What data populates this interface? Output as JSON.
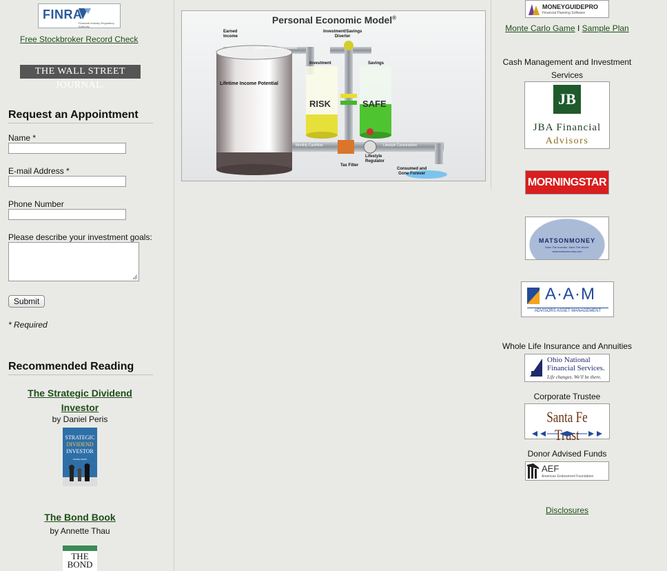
{
  "left": {
    "finra_logo_text": "FINRA",
    "finra_logo_sub": "Financial Industry Regulatory Authority",
    "stockbroker_link": "Free Stockbroker Record Check",
    "wsj_logo_text": "THE WALL STREET JOURNAL.",
    "appointment": {
      "heading": "Request an Appointment",
      "name_label": "Name *",
      "email_label": "E-mail Address *",
      "phone_label": "Phone Number",
      "goals_label": "Please describe your investment goals:",
      "submit_label": "Submit",
      "required_note": "* Required"
    },
    "reading": {
      "heading": "Recommended Reading",
      "books": [
        {
          "title_line1": "The Strategic Dividend",
          "title_line2": "Investor",
          "author": "by Daniel Peris",
          "cover_line1": "STRATEGIC",
          "cover_line2": "DIVIDEND",
          "cover_line3": "INVESTOR",
          "cover_line4": "DANIEL PERIS"
        },
        {
          "title": "The Bond Book",
          "author": "by Annette Thau",
          "cover_line1": "THE",
          "cover_line2": "BOND"
        }
      ]
    }
  },
  "center": {
    "diagram": {
      "title": "Personal Economic Model",
      "registered": "®",
      "labels": {
        "earned_income": "Earned\nIncome",
        "qualified": "Qualified Plan Contributions",
        "inv_diverter": "Investment/Savings\nDiverter",
        "investment": "Investment",
        "savings": "Savings",
        "lifetime": "Lifetime Income Potential",
        "risk": "RISK",
        "safe": "SAFE",
        "monthly_cashflow": "Monthly Cashflow",
        "lifestyle_consumption": "Lifestyle Consumption",
        "tax_filter": "Tax Filter",
        "lifestyle_regulator": "Lifestyle\nRegulator",
        "consumed": "Consumed and\nGone Forever"
      }
    }
  },
  "right": {
    "mgp_logo_text": "MONEYGUIDEPRO",
    "mgp_logo_sub": "Financial Planning Software",
    "monte_carlo_link": "Monte Carlo Game",
    "separator": "I",
    "sample_plan_link": "Sample Plan",
    "cash_heading": "Cash Management and Investment Services",
    "jba_mark": "JB",
    "jba_line1": "JBA Financial",
    "jba_line2": "Advisors",
    "morningstar": "MORNINGSTAR",
    "matson_name": "MATSONMONEY",
    "matson_tag": "Save The Investor. Save The World.",
    "matson_url": "www.matsonmoney.com",
    "aam_mark": "A·A·M",
    "aam_sub": "ADVISORS ASSET MANAGEMENT",
    "insurance_heading": "Whole Life Insurance and Annuities",
    "ohio_line1": "Ohio National",
    "ohio_line2": "Financial Services.",
    "ohio_tag": "Life changes. We'll be there.",
    "trustee_heading": "Corporate Trustee",
    "santa_fe": "Santa Fe Trust",
    "donor_heading": "Donor Advised Funds",
    "aef_mark": "AEF",
    "aef_sub": "American Endowment Foundation",
    "disclosures_link": "Disclosures"
  }
}
